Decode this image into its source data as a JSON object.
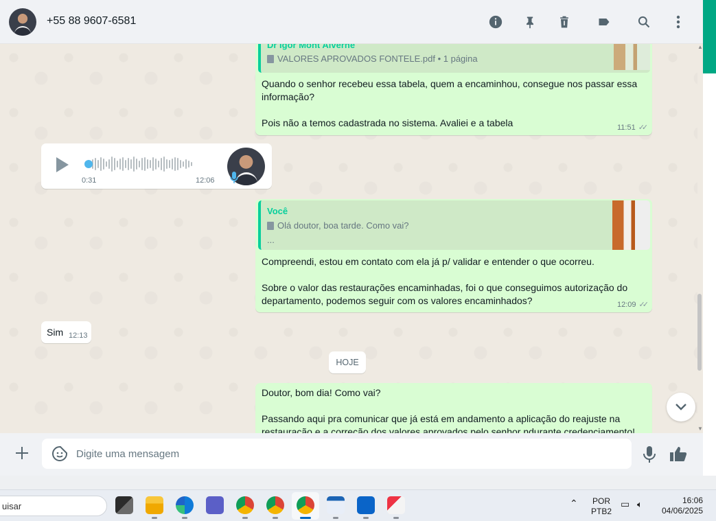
{
  "header": {
    "contact_name": "+55 88 9607-6581",
    "icons": [
      "info-icon",
      "pin-icon",
      "trash-icon",
      "label-icon",
      "search-icon",
      "more-vertical-icon"
    ]
  },
  "messages": {
    "m1": {
      "quote_author": "Dr Igor Mont Alverne",
      "quote_file": "VALORES APROVADOS FONTELE.pdf • 1 página",
      "text_line1": "Quando o senhor recebeu essa tabela, quem a encaminhou, consegue nos passar essa",
      "text_line2": "informação?",
      "text_line3": "Pois não a temos cadastrada no sistema. Avaliei e a tabela",
      "time": "11:51"
    },
    "audio": {
      "duration": "0:31",
      "time": "12:06"
    },
    "m2": {
      "quote_author": "Você",
      "quote_line1": "Olá doutor, boa tarde. Como vai?",
      "quote_line2": "...",
      "text_line1": "Compreendi, estou em contato com ela já p/ validar e entender o que ocorreu.",
      "text_line2": "Sobre o valor das restaurações encaminhadas, foi o que conseguimos autorização do",
      "text_line3": "departamento, podemos seguir com os valores encaminhados?",
      "time": "12:09"
    },
    "m3": {
      "text": "Sim",
      "time": "12:13"
    },
    "day_divider": "HOJE",
    "m4": {
      "text_line1": "Doutor, bom dia! Como vai?",
      "text_line2": "Passando aqui pra comunicar que já está em andamento a aplicação do reajuste na",
      "text_line3": "restauração e a correção dos valores aprovados pelo senhor ndurante credenciamento!"
    }
  },
  "footer": {
    "placeholder": "Digite uma mensagem"
  },
  "taskbar": {
    "search_text": "uisar",
    "language_line1": "POR",
    "language_line2": "PTB2",
    "clock_time": "16:06",
    "clock_date": "04/06/2025"
  },
  "colors": {
    "outgoing_bubble": "#d9fdd3",
    "incoming_bubble": "#ffffff",
    "accent": "#00a884",
    "chat_background": "#efeae2"
  }
}
